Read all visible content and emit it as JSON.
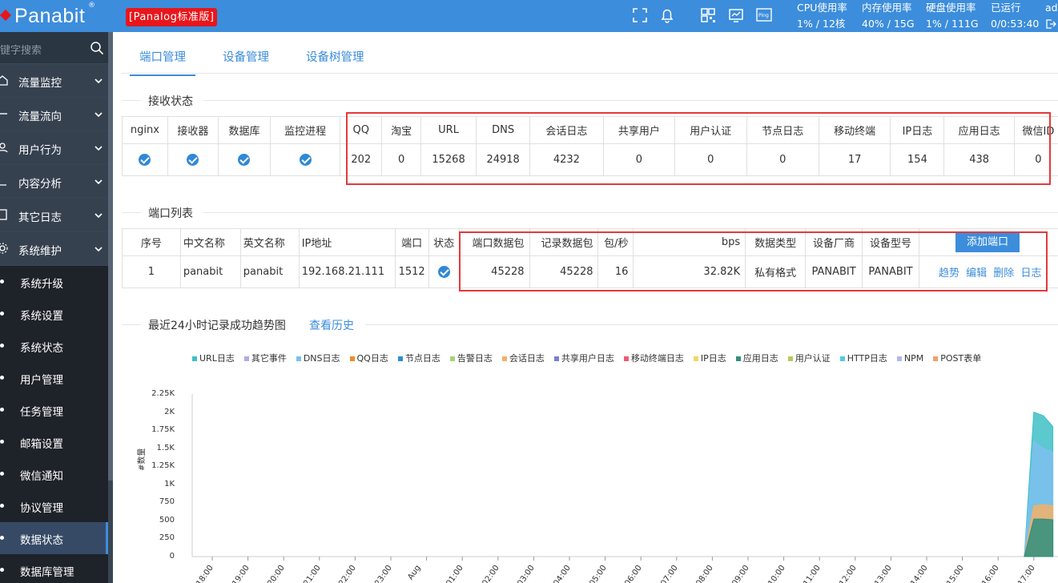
{
  "header": {
    "brand": "Panabit",
    "registered": "®",
    "edition": "[Panalog标准版]",
    "icons": [
      "fullscreen-icon",
      "bell-icon",
      "qr-icon",
      "monitor-icon",
      "ping-icon"
    ],
    "stats": [
      {
        "label": "CPU使用率",
        "value": "1% / 12核"
      },
      {
        "label": "内存使用率",
        "value": "40% / 15G"
      },
      {
        "label": "硬盘使用率",
        "value": "1% / 111G"
      },
      {
        "label": "已运行",
        "value": "0/0:53:40"
      },
      {
        "label": "adı",
        "value": ""
      }
    ]
  },
  "sidebar": {
    "search_placeholder": "键字搜索",
    "menu": [
      {
        "label": "流量监控",
        "icon": "home-icon"
      },
      {
        "label": "流量流向",
        "icon": "flow-icon"
      },
      {
        "label": "用户行为",
        "icon": "user-icon"
      },
      {
        "label": "内容分析",
        "icon": "analysis-icon"
      },
      {
        "label": "其它日志",
        "icon": "log-icon"
      },
      {
        "label": "系统维护",
        "icon": "gear-icon"
      }
    ],
    "submenu": [
      {
        "label": "系统升级"
      },
      {
        "label": "系统设置"
      },
      {
        "label": "系统状态"
      },
      {
        "label": "用户管理"
      },
      {
        "label": "任务管理"
      },
      {
        "label": "邮箱设置"
      },
      {
        "label": "微信通知"
      },
      {
        "label": "协议管理"
      },
      {
        "label": "数据状态"
      },
      {
        "label": "数据库管理"
      }
    ],
    "active_submenu": "数据状态"
  },
  "tabs": [
    {
      "label": "端口管理",
      "active": true
    },
    {
      "label": "设备管理",
      "active": false
    },
    {
      "label": "设备树管理",
      "active": false
    }
  ],
  "receive_status": {
    "title": "接收状态",
    "status_headers": [
      "nginx",
      "接收器",
      "数据库",
      "监控进程"
    ],
    "count_headers": [
      "QQ",
      "淘宝",
      "URL",
      "DNS",
      "会话日志",
      "共享用户",
      "用户认证",
      "节点日志",
      "移动终端",
      "IP日志",
      "应用日志",
      "微信ID"
    ],
    "counts": [
      "202",
      "0",
      "15268",
      "24918",
      "4232",
      "0",
      "0",
      "0",
      "17",
      "154",
      "438",
      "0"
    ]
  },
  "port_list": {
    "title": "端口列表",
    "headers": [
      "序号",
      "中文名称",
      "英文名称",
      "IP地址",
      "端口",
      "状态",
      "端口数据包",
      "记录数据包",
      "包/秒",
      "bps",
      "数据类型",
      "设备厂商",
      "设备型号"
    ],
    "add_button": "添加端口",
    "rows": [
      {
        "index": "1",
        "cn_name": "panabit",
        "en_name": "panabit",
        "ip": "192.168.21.111",
        "port": "1512",
        "port_packets": "45228",
        "record_packets": "45228",
        "pps": "16",
        "bps": "32.82K",
        "data_type": "私有格式",
        "vendor": "PANABIT",
        "model": "PANABIT"
      }
    ],
    "actions": [
      "趋势",
      "编辑",
      "删除",
      "日志"
    ]
  },
  "trend": {
    "title": "最近24小时记录成功趋势图",
    "history_link": "查看历史"
  },
  "chart_data": {
    "type": "area",
    "ylabel": "#数量",
    "yticks": [
      "0",
      "250",
      "500",
      "750",
      "1K",
      "1.25K",
      "1.5K",
      "1.75K",
      "2K",
      "2.25K"
    ],
    "ylim": [
      0,
      2250
    ],
    "xticks": [
      "18:00",
      "19:00",
      "20:00",
      "21:00",
      "22:00",
      "23:00",
      "Aug",
      "01:00",
      "02:00",
      "03:00",
      "04:00",
      "05:00",
      "06:00",
      "07:00",
      "08:00",
      "09:00",
      "10:00",
      "11:00",
      "12:00",
      "13:00",
      "14:00",
      "15:00",
      "16:00",
      "17:00"
    ],
    "legend": [
      {
        "name": "URL日志",
        "color": "#3ebfc6"
      },
      {
        "name": "其它事件",
        "color": "#b7a8e6"
      },
      {
        "name": "DNS日志",
        "color": "#7cc0ef"
      },
      {
        "name": "QQ日志",
        "color": "#f28a2c"
      },
      {
        "name": "节点日志",
        "color": "#2b8fd4"
      },
      {
        "name": "告警日志",
        "color": "#a4d37a"
      },
      {
        "name": "会话日志",
        "color": "#f4b066"
      },
      {
        "name": "共享用户日志",
        "color": "#7a7fd8"
      },
      {
        "name": "移动终端日志",
        "color": "#ef5a73"
      },
      {
        "name": "IP日志",
        "color": "#f4d55e"
      },
      {
        "name": "应用日志",
        "color": "#2f8f7e"
      },
      {
        "name": "用户认证",
        "color": "#b9c95b"
      },
      {
        "name": "HTTP日志",
        "color": "#55c8e0"
      },
      {
        "name": "NPM",
        "color": "#b2b6ef"
      },
      {
        "name": "POST表单",
        "color": "#f0a070"
      }
    ],
    "series": [
      {
        "name": "URL日志",
        "x": [
          "16:55",
          "17:00",
          "17:05",
          "17:10"
        ],
        "values": [
          0,
          2000,
          1950,
          1800
        ]
      },
      {
        "name": "DNS日志",
        "x": [
          "16:55",
          "17:00",
          "17:05",
          "17:10"
        ],
        "values": [
          0,
          1600,
          1500,
          1450
        ]
      },
      {
        "name": "会话日志",
        "x": [
          "16:55",
          "17:00",
          "17:05",
          "17:10"
        ],
        "values": [
          0,
          700,
          720,
          700
        ]
      },
      {
        "name": "应用日志",
        "x": [
          "16:55",
          "17:00",
          "17:05",
          "17:10"
        ],
        "values": [
          0,
          520,
          520,
          510
        ]
      }
    ]
  }
}
